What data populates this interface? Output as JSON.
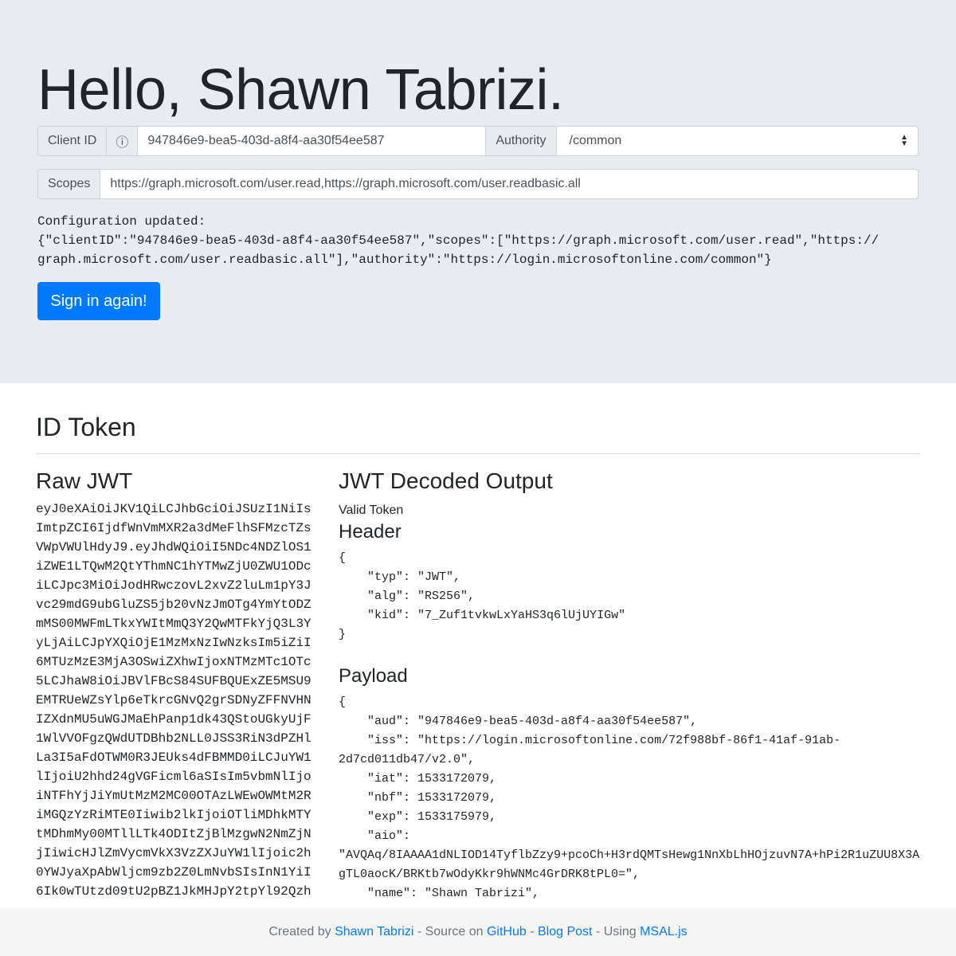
{
  "header": {
    "title": "Hello, Shawn Tabrizi."
  },
  "config": {
    "client_id_label": "Client ID",
    "info_icon": "info-circle-icon",
    "info_glyph": "ⓘ",
    "client_id_value": "947846e9-bea5-403d-a8f4-aa30f54ee587",
    "authority_label": "Authority",
    "authority_value": "/common",
    "scopes_label": "Scopes",
    "scopes_value": "https://graph.microsoft.com/user.read,https://graph.microsoft.com/user.readbasic.all",
    "status": "Configuration updated:\n{\"clientID\":\"947846e9-bea5-403d-a8f4-aa30f54ee587\",\"scopes\":[\"https://graph.microsoft.com/user.read\",\"https://graph.microsoft.com/user.readbasic.all\"],\"authority\":\"https://login.microsoftonline.com/common\"}",
    "sign_in_label": "Sign in again!"
  },
  "token": {
    "section_title": "ID Token",
    "raw_title": "Raw JWT",
    "raw_jwt": "eyJ0eXAiOiJKV1QiLCJhbGciOiJSUzI1NiIsImtpZCI6IjdfWnVmMXR2a3dMeFlhSFMzcTZsVWpVWUlHdyJ9.eyJhdWQiOiI5NDc4NDZlOS1iZWE1LTQwM2QtYThmNC1hYTMwZjU0ZWU1ODciLCJpc3MiOiJodHRwczovL2xvZ2luLm1pY3Jvc29mdG9ubGluZS5jb20vNzJmOTg4YmYtODZmMS00MWFmLTkxYWItMmQ3Y2QwMTFkYjQ3L3YyLjAiLCJpYXQiOjE1MzMxNzIwNzksIm5iZiI6MTUzMzE3MjA3OSwiZXhwIjoxNTMzMTc1OTc5LCJhaW8iOiJBVlFBcS84SUFBQUExZE5MSU9EMTRUeWZsYlp6eTkrcGNvQ2grSDNyZFFNVHNIZXdnMU5uWGJMaEhPanp1dk43QStoUGkyUjF1WlVVOFgzQWdUTDBhb2NLL0JSS3RiN3dPZHlLa3I5aFdOTWM0R3JEUks4dFBMMD0iLCJuYW1lIjoiU2hhd24gVGFicml6aSIsIm5vbmNlIjoiNTFhYjJiYmUtMzM2MC00OTAzLWEwOWMtM2RiMGQzYzRiMTE0Iiwib2lkIjoiOTliMDhkMTYtMDhmMy00MTllLTk4ODItZjBlMzgwN2NmZjNjIiwicHJlZmVycmVkX3VzZXJuYW1lIjoic2h0YWJyaXpAbWljcm9zb2Z0LmNvbSIsInN1YiI6Ik0wTUtzd09tU2pBZ1JkMHJpY2tpYl92Qzh",
    "decoded_title": "JWT Decoded Output",
    "valid_text": "Valid Token",
    "header_title": "Header",
    "header_json": "{\n    \"typ\": \"JWT\",\n    \"alg\": \"RS256\",\n    \"kid\": \"7_Zuf1tvkwLxYaHS3q6lUjUYIGw\"\n}",
    "payload_title": "Payload",
    "payload_json": "{\n    \"aud\": \"947846e9-bea5-403d-a8f4-aa30f54ee587\",\n    \"iss\": \"https://login.microsoftonline.com/72f988bf-86f1-41af-91ab-2d7cd011db47/v2.0\",\n    \"iat\": 1533172079,\n    \"nbf\": 1533172079,\n    \"exp\": 1533175979,\n    \"aio\": \"AVQAq/8IAAAA1dNLIOD14TyflbZzy9+pcoCh+H3rdQMTsHewg1NnXbLhHOjzuvN7A+hPi2R1uZUU8X3AgTL0aocK/BRKtb7wOdyKkr9hWNMc4GrDRK8tPL0=\",\n    \"name\": \"Shawn Tabrizi\","
  },
  "footer": {
    "created_by": "Created by ",
    "author_link": "Shawn Tabrizi",
    "source_on": " - Source on ",
    "github_link": "GitHub",
    "sep": " - ",
    "blog_link": "Blog Post",
    "using": " - Using ",
    "msal_link": "MSAL.js"
  },
  "colors": {
    "primary": "#007bff",
    "jumbotron": "#e9ecef",
    "footer": "#f5f5f5"
  }
}
